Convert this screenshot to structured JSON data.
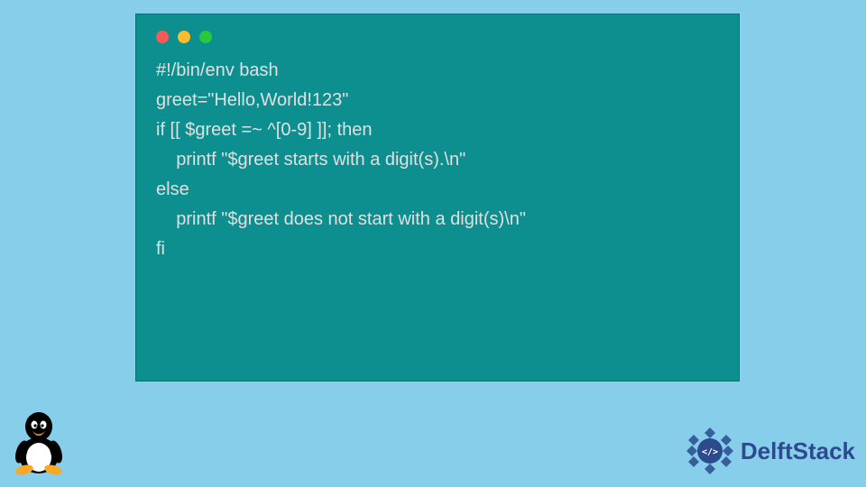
{
  "code": {
    "lines": [
      "#!/bin/env bash",
      "",
      "greet=\"Hello,World!123\"",
      "",
      "if [[ $greet =~ ^[0-9] ]]; then",
      "    printf \"$greet starts with a digit(s).\\n\"",
      "else",
      "    printf \"$greet does not start with a digit(s)\\n\"",
      "fi"
    ]
  },
  "brand": {
    "name": "DelftStack"
  }
}
